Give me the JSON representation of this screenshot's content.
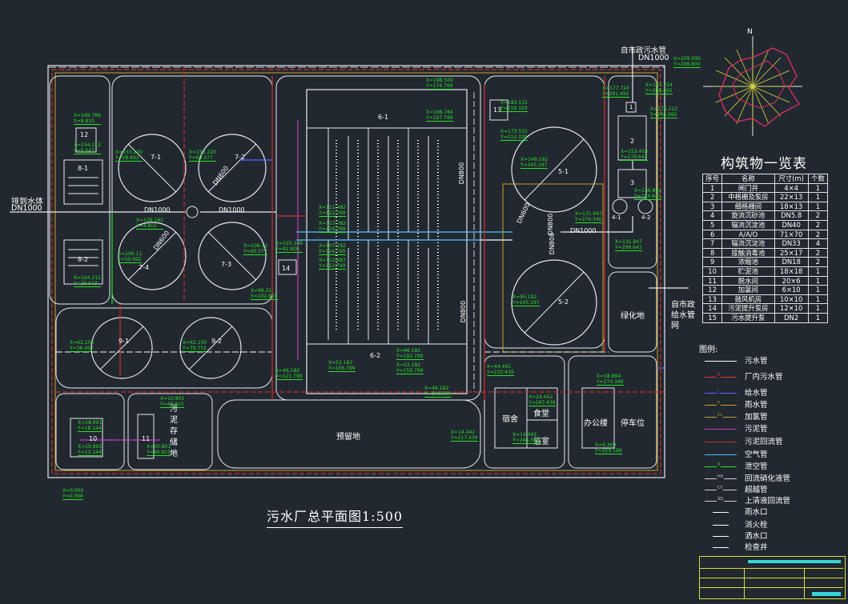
{
  "drawing_title": "污水厂总平面图1:500",
  "table_title": "构筑物一览表",
  "table_header": [
    "序号",
    "名称",
    "尺寸(m)",
    "个数"
  ],
  "table_rows": [
    [
      "1",
      "闸门井",
      "4×4",
      "1"
    ],
    [
      "2",
      "中格栅及泵房",
      "22×13",
      "1"
    ],
    [
      "3",
      "细格栅间",
      "18×13",
      "1"
    ],
    [
      "4",
      "旋流沉砂池",
      "DN5.8",
      "2"
    ],
    [
      "5",
      "辐流沉淀池",
      "DN40",
      "2"
    ],
    [
      "6",
      "A/A/O",
      "71×70",
      "2"
    ],
    [
      "7",
      "辐流沉淀池",
      "DN33",
      "4"
    ],
    [
      "8",
      "接触消毒池",
      "25×17",
      "2"
    ],
    [
      "9",
      "浓缩池",
      "DN18",
      "2"
    ],
    [
      "10",
      "贮泥池",
      "18×18",
      "1"
    ],
    [
      "11",
      "脱水间",
      "20×6",
      "1"
    ],
    [
      "12",
      "加氯间",
      "6×10",
      "1"
    ],
    [
      "13",
      "鼓风机房",
      "10×10",
      "1"
    ],
    [
      "14",
      "污泥提升泵房",
      "12×10",
      "1"
    ],
    [
      "15",
      "污水提升泵",
      "DN2",
      "1"
    ]
  ],
  "legend_title": "图例:",
  "legend": [
    {
      "label": "污水管",
      "code": "",
      "color": "#ffffff"
    },
    {
      "label": "厂内污水管",
      "code": "K",
      "color": "#e33a3a"
    },
    {
      "label": "给水管",
      "code": "J",
      "color": "#5c63ff"
    },
    {
      "label": "雨水管",
      "code": "Y",
      "color": "#d0a12a"
    },
    {
      "label": "加氯管",
      "code": "CL",
      "color": "#b8a13a"
    },
    {
      "label": "污泥管",
      "code": "",
      "color": "#c23cc6"
    },
    {
      "label": "污泥回流管",
      "code": "",
      "color": "#d42c2c"
    },
    {
      "label": "空气管",
      "code": "",
      "color": "#4fc3ff"
    },
    {
      "label": "泄空管",
      "code": "X",
      "color": "#27e127"
    },
    {
      "label": "回流硝化液管",
      "code": "HX",
      "color": "#cfcfcf"
    },
    {
      "label": "超越管",
      "code": "CY",
      "color": "#cfcfcf"
    },
    {
      "label": "上清液回流管",
      "code": "SQ",
      "color": "#cfcfcf"
    },
    {
      "label": "雨水口",
      "code": "",
      "color": "#ffffff"
    },
    {
      "label": "消火栓",
      "code": "",
      "color": "#ffffff"
    },
    {
      "label": "洒水口",
      "code": "",
      "color": "#ffffff"
    },
    {
      "label": "检查井",
      "code": "",
      "color": "#ffffff"
    }
  ],
  "labels": {
    "inlet_top": "自市政污水管",
    "inlet_dn": "DN1000",
    "discharge": "排到水体",
    "discharge_dn": "DN1000",
    "water_supply_1": "自市政",
    "water_supply_2": "给水管",
    "water_supply_3": "网",
    "reserved": "预留地",
    "green": "绿化地",
    "dorm": "宿舍",
    "canteen": "食堂",
    "bath": "浴室",
    "office": "办公楼",
    "parking": "停车位",
    "sludge_yard": [
      "污",
      "泥",
      "存",
      "储",
      "地"
    ],
    "north": "N",
    "dn1000_a": "DN1000",
    "dn1000_b": "DN1000",
    "dn1000_c": "DN1000",
    "dn600_a": "DN600",
    "dn600_b": "DN600",
    "dn800_a": "DN800",
    "dn800_b": "DN800",
    "dn800_c": "DN800",
    "dn800_d": "DN800",
    "dn600_c": "DN600"
  },
  "unit_labels": {
    "u6_1": "6-1",
    "u6_2": "6-2",
    "u5_1": "5-1",
    "u5_2": "5-2",
    "u7_1": "7-1",
    "u7_2": "7-2",
    "u7_3": "7-3",
    "u7_4": "7-4",
    "u9_1": "9-1",
    "u9_2": "9-2",
    "u8_1": "8-1",
    "u8_2": "8-2",
    "u4_1": "4-1",
    "u4_2": "4-2",
    "u1": "1",
    "u2": "2",
    "u3": "3",
    "u10": "10",
    "u11": "11",
    "u12": "12",
    "u13": "13",
    "u14": "14"
  },
  "coords": [
    {
      "x": "X=169.766",
      "y": "Y=8.810"
    },
    {
      "x": "X=154.212",
      "y": "Y=8.643"
    },
    {
      "x": "X=153.220",
      "y": "Y=58.692"
    },
    {
      "x": "X=153.220",
      "y": "Y=69.577"
    },
    {
      "x": "X=129.182",
      "y": "Y=4.802"
    },
    {
      "x": "X=106.11",
      "y": "Y=50.692"
    },
    {
      "x": "X=104.212",
      "y": "Y=26.643"
    },
    {
      "x": "X=106.11",
      "y": "Y=90.577"
    },
    {
      "x": "X=125.349",
      "y": "Y=92.826"
    },
    {
      "x": "X=99.31",
      "y": "Y=102.825"
    },
    {
      "x": "X=62.204",
      "y": "Y=36.457"
    },
    {
      "x": "X=62.100",
      "y": "Y=79.772"
    },
    {
      "x": "X=46.182",
      "y": "Y=121.799"
    },
    {
      "x": "X=198.500",
      "y": "Y=174.799"
    },
    {
      "x": "X=168.784",
      "y": "Y=197.799"
    },
    {
      "x": "X=183.531",
      "y": "Y=218.329"
    },
    {
      "x": "X=173.531",
      "y": "Y=212.329"
    },
    {
      "x": "X=149.192",
      "y": "Y=245.197"
    },
    {
      "x": "X=121.482",
      "y": "Y=122.799"
    },
    {
      "x": "X=117.782",
      "y": "Y=124.799"
    },
    {
      "x": "X=107.192",
      "y": "Y=124.799"
    },
    {
      "x": "X=112.487",
      "y": "Y=122.799"
    },
    {
      "x": "X=52.182",
      "y": "Y=156.799"
    },
    {
      "x": "X=66.182",
      "y": "Y=192.799"
    },
    {
      "x": "X=52.182",
      "y": "Y=159.799"
    },
    {
      "x": "X=46.182",
      "y": "Y=196.799"
    },
    {
      "x": "X=95.192",
      "y": "Y=245.197"
    },
    {
      "x": "X=131.947",
      "y": "Y=276.340"
    },
    {
      "x": "X=131.947",
      "y": "Y=298.643"
    },
    {
      "x": "X=136.892",
      "y": "Y=284.643"
    },
    {
      "x": "X=153.415",
      "y": "Y=276.643"
    },
    {
      "x": "X=176.212",
      "y": "Y=266.992"
    },
    {
      "x": "X=177.724",
      "y": "Y=281.492"
    },
    {
      "x": "X=181.724",
      "y": "Y=288.492"
    },
    {
      "x": "X=209.090",
      "y": "Y=298.800"
    },
    {
      "x": "X=44.442",
      "y": "Y=232.439"
    },
    {
      "x": "X=24.442",
      "y": "Y=247.439"
    },
    {
      "x": "X=14.442",
      "y": "Y=246.343"
    },
    {
      "x": "X=14.442",
      "y": "Y=217.439"
    },
    {
      "x": "X=38.864",
      "y": "Y=274.349"
    },
    {
      "x": "X=6.369",
      "y": "Y=259.199"
    },
    {
      "x": "X=28.991",
      "y": "Y=18.144"
    },
    {
      "x": "X=10.991",
      "y": "Y=13.144"
    },
    {
      "x": "X=10.801",
      "y": "Y=49.815"
    },
    {
      "x": "X=30.801",
      "y": "Y=49.815"
    },
    {
      "x": "X=0.000",
      "y": "Y=0.000"
    }
  ],
  "colors": {
    "bg": "#212830",
    "green": "#27e127",
    "outline": "#e8eaec",
    "red": "#d42c2c",
    "blue": "#5c63ff",
    "yellow": "#d0a12a",
    "magenta": "#c23cc6",
    "cyan": "#4fc3ff",
    "titleblock": "#d9dc3a",
    "rose": "#e32d67"
  }
}
